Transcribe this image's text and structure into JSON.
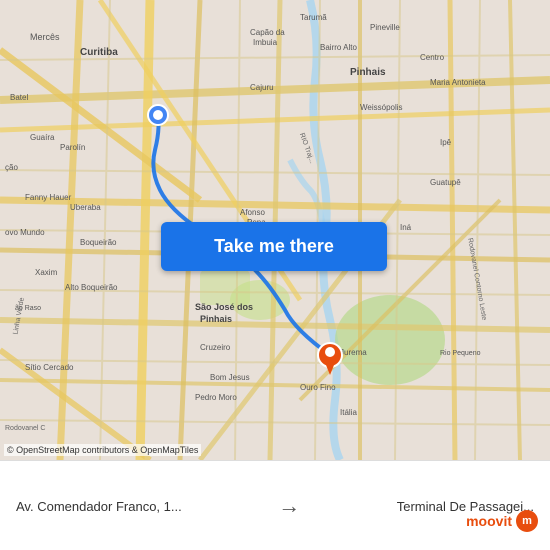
{
  "map": {
    "attribution": "© OpenStreetMap contributors & OpenMapTiles",
    "button_label": "Take me there",
    "marker_color_origin": "#4285F4",
    "marker_color_dest": "#E84D0E"
  },
  "bottom_bar": {
    "origin_label": "Av. Comendador Franco, 1...",
    "destination_label": "Terminal De Passagei...",
    "arrow": "→"
  },
  "moovit": {
    "logo_text": "moovit"
  }
}
